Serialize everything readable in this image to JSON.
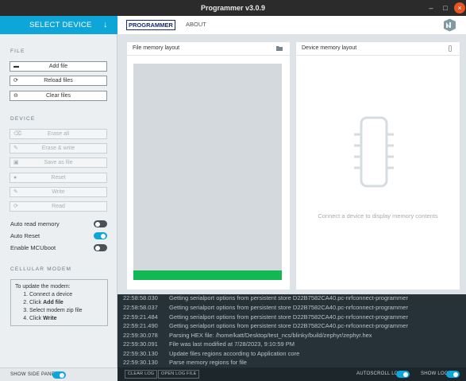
{
  "window": {
    "title": "Programmer v3.0.9",
    "controls": {
      "minimize": "–",
      "maximize": "□",
      "close": "×"
    }
  },
  "sidebar": {
    "select_device": {
      "label": "SELECT DEVICE",
      "arrow": "↓"
    },
    "file_section": {
      "title": "FILE",
      "buttons": [
        {
          "label": "Add file",
          "icon": "folder-open-icon",
          "glyph": "▬",
          "enabled": true
        },
        {
          "label": "Reload files",
          "icon": "refresh-icon",
          "glyph": "⟳",
          "enabled": true
        },
        {
          "label": "Clear files",
          "icon": "minus-circle-icon",
          "glyph": "⊖",
          "enabled": true
        }
      ]
    },
    "device_section": {
      "title": "DEVICE",
      "buttons": [
        {
          "label": "Erase all",
          "icon": "eraser-icon",
          "glyph": "⌫",
          "enabled": false
        },
        {
          "label": "Erase & write",
          "icon": "pencil-icon",
          "glyph": "✎",
          "enabled": false
        },
        {
          "label": "Save as file",
          "icon": "save-icon",
          "glyph": "▣",
          "enabled": false
        },
        {
          "label": "Reset",
          "icon": "reset-icon",
          "glyph": "●",
          "enabled": false
        },
        {
          "label": "Write",
          "icon": "pencil-icon",
          "glyph": "✎",
          "enabled": false
        },
        {
          "label": "Read",
          "icon": "refresh-icon",
          "glyph": "⟳",
          "enabled": false
        }
      ]
    },
    "toggles": [
      {
        "label": "Auto read memory",
        "on": false
      },
      {
        "label": "Auto Reset",
        "on": true
      },
      {
        "label": "Enable MCUboot",
        "on": false
      }
    ],
    "cellular_section": {
      "title": "CELLULAR MODEM",
      "intro": "To update the modem:",
      "steps": [
        {
          "pre": "Connect a device",
          "bold": ""
        },
        {
          "pre": "Click ",
          "bold": "Add file"
        },
        {
          "pre": "Select modem zip file",
          "bold": ""
        },
        {
          "pre": "Click ",
          "bold": "Write"
        }
      ]
    },
    "footer": {
      "label": "SHOW SIDE PANEL",
      "on": true
    }
  },
  "nav": {
    "tabs": [
      {
        "label": "PROGRAMMER",
        "active": true
      },
      {
        "label": "ABOUT",
        "active": false
      }
    ]
  },
  "file_panel": {
    "title": "File memory layout",
    "icon": "folder-icon"
  },
  "device_panel": {
    "title": "Device memory layout",
    "icon": "chip-small-icon",
    "empty_message": "Connect a device to display memory contents"
  },
  "log": {
    "entries": [
      {
        "time": "22:58:58.030",
        "message": "Getting serialport options from persistent store D22B7582CA40.pc-nrfconnect-programmer"
      },
      {
        "time": "22:58:58.037",
        "message": "Getting serialport options from persistent store D22B7582CA40.pc-nrfconnect-programmer"
      },
      {
        "time": "22:59:21.484",
        "message": "Getting serialport options from persistent store D22B7582CA40.pc-nrfconnect-programmer"
      },
      {
        "time": "22:59:21.490",
        "message": "Getting serialport options from persistent store D22B7582CA40.pc-nrfconnect-programmer"
      },
      {
        "time": "22:59:30.078",
        "message": "Parsing HEX file: /home/katt/Desktop/test_ncs/blinky/build/zephyr/zephyr.hex"
      },
      {
        "time": "22:59:30.091",
        "message": "File was last modified at 7/28/2023, 9:10:59 PM"
      },
      {
        "time": "22:59:30.130",
        "message": "Update files regions according to Application core"
      },
      {
        "time": "22:59:30.130",
        "message": "Parse memory regions for file"
      }
    ],
    "footer": {
      "clear_log": "CLEAR LOG",
      "open_log_file": "OPEN LOG FILE",
      "autoscroll_label": "AUTOSCROLL LOG",
      "autoscroll_on": true,
      "show_log_label": "SHOW LOG",
      "show_log_on": true
    }
  },
  "colors": {
    "accent": "#0ea5d9",
    "region_green": "#12b854",
    "log_bg": "#263238",
    "title_bar": "#2b2b2b",
    "close_button": "#e95420"
  }
}
